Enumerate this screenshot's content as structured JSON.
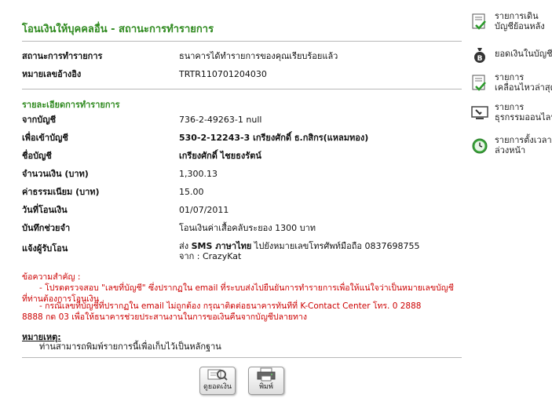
{
  "page": {
    "title": "โอนเงินให้บุคคลอื่น - สถานะการทำรายการ"
  },
  "status": {
    "status_label": "สถานะการทำรายการ",
    "status_value": "ธนาคารได้ทำรายการของคุณเรียบร้อยแล้ว",
    "ref_label": "หมายเลขอ้างอิง",
    "ref_value": "TRTR110701204030"
  },
  "details": {
    "section_title": "รายละเอียดการทำรายการ",
    "rows": [
      {
        "label": "จากบัญชี",
        "value": "736-2-49263-1 null"
      },
      {
        "label": "เพื่อเข้าบัญชี",
        "value": "530-2-12243-3 เกรียงศักดิ์ ธ.กสิกร(แหลมทอง)"
      },
      {
        "label": "ชื่อบัญชี",
        "value": "เกรียงศักดิ์ ไชยธงรัตน์"
      },
      {
        "label": "จำนวนเงิน (บาท)",
        "value": "1,300.13"
      },
      {
        "label": "ค่าธรรมเนียม (บาท)",
        "value": "15.00"
      },
      {
        "label": "วันที่โอนเงิน",
        "value": "01/07/2011"
      },
      {
        "label": "บันทึกช่วยจำ",
        "value": "โอนเงินค่าเสื้อคลับระยอง 1300 บาท"
      }
    ],
    "notify_label": "แจ้งผู้รับโอน",
    "notify_line1_prefix": "ส่ง ",
    "notify_line1_bold": "SMS ภาษาไทย",
    "notify_line1_rest": " ไปยังหมายเลขโทรศัพท์มือถือ 0837698755",
    "notify_line2": "จาก : CrazyKat"
  },
  "notice": {
    "heading": "ข้อความสำคัญ :",
    "line1": "- โปรดตรวจสอบ \"เลขที่บัญชี\" ซึ่งปรากฏใน email ที่ระบบส่งไปยืนยันการทำรายการเพื่อให้แน่ใจว่าเป็นหมายเลขบัญชี",
    "line2": "ที่ท่านต้องการโอนเงิน",
    "line3": "- กรณีเลขที่บัญชีที่ปรากฏใน email ไม่ถูกต้อง กรุณาติดต่อธนาคารทันทีที่ K-Contact Center โทร. 0 2888",
    "line4": "8888 กด 03 เพื่อให้ธนาคารช่วยประสานงานในการขอเงินคืนจากบัญชีปลายทาง"
  },
  "remark": {
    "heading": "หมายเหตุ:",
    "text": "ท่านสามารถพิมพ์รายการนี้เพื่อเก็บไว้เป็นหลักฐาน"
  },
  "buttons": {
    "view_balance": "ดูยอดเงิน",
    "print": "พิมพ์"
  },
  "sidebar": {
    "items": [
      {
        "line1": "รายการเดิน",
        "line2": "บัญชีย้อนหลัง",
        "icon": "check-document-icon"
      },
      {
        "line1": "ยอดเงินในบัญชี",
        "line2": "",
        "icon": "money-bag-icon"
      },
      {
        "line1": "รายการ",
        "line2": "เคลื่อนไหวล่าสุด",
        "icon": "document-check-icon"
      },
      {
        "line1": "รายการ",
        "line2": "ธุรกรรมออนไลน์",
        "icon": "computer-icon"
      },
      {
        "line1": "รายการตั้งเวลา",
        "line2": "ล่วงหน้า",
        "icon": "clock-icon"
      }
    ]
  },
  "colors": {
    "title_green": "#2f8a1f",
    "notice_red": "#cc0000"
  }
}
